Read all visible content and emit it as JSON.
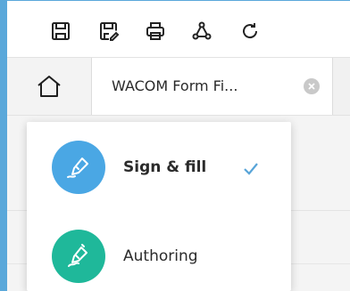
{
  "toolbar": {
    "icons": [
      "save-icon",
      "save-as-icon",
      "print-icon",
      "share-icon",
      "redo-icon"
    ]
  },
  "tabs": {
    "home_icon": "home-icon",
    "document_tab": {
      "title": "WACOM Form Fi...",
      "close_icon": "close-icon"
    }
  },
  "mode_menu": {
    "items": [
      {
        "label": "Sign & fill",
        "icon": "pen-sign-icon",
        "color": "#4aa7e4",
        "selected": true
      },
      {
        "label": "Authoring",
        "icon": "pen-author-icon",
        "color": "#1fb89a",
        "selected": false
      }
    ],
    "check_color": "#58a4d8"
  },
  "colors": {
    "window_accent": "#5aa8da",
    "tab_bar": "#f1f1f1"
  }
}
